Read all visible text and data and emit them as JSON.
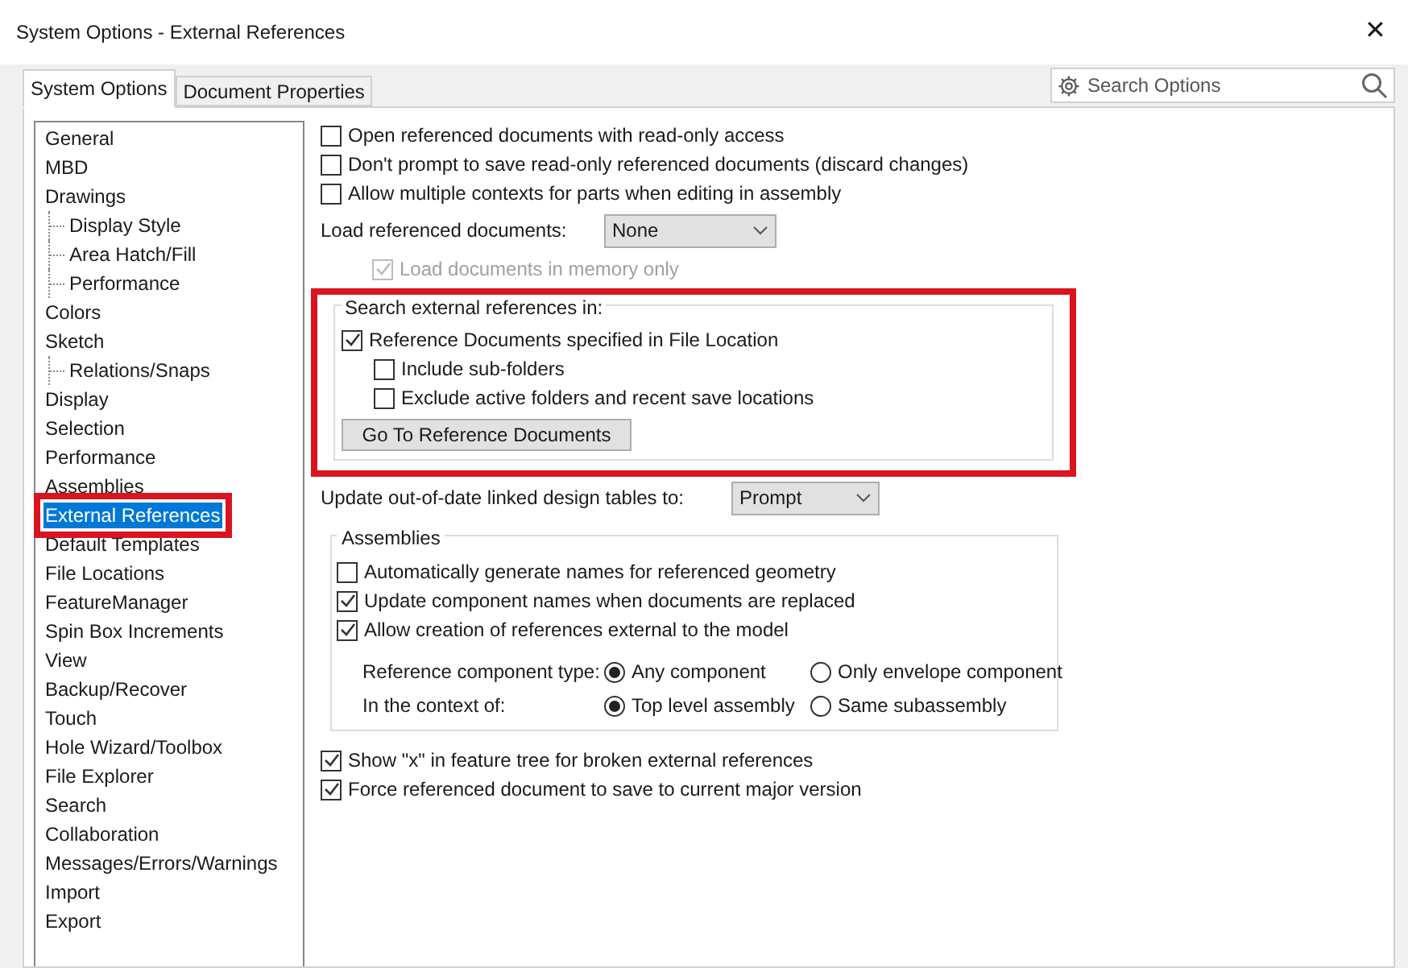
{
  "window": {
    "title": "System Options - External References",
    "close": "✕"
  },
  "tabs": [
    {
      "label": "System Options",
      "selected": true
    },
    {
      "label": "Document Properties",
      "selected": false
    }
  ],
  "search": {
    "placeholder": "Search Options"
  },
  "sidebar": {
    "items": [
      {
        "label": "General",
        "selected": false,
        "highlighted": false
      },
      {
        "label": "MBD",
        "selected": false,
        "highlighted": false
      },
      {
        "label": "Drawings",
        "selected": false,
        "highlighted": false,
        "children": [
          {
            "label": "Display Style",
            "selected": false,
            "highlighted": false
          },
          {
            "label": "Area Hatch/Fill",
            "selected": false,
            "highlighted": false
          },
          {
            "label": "Performance",
            "selected": false,
            "highlighted": false
          }
        ]
      },
      {
        "label": "Colors",
        "selected": false,
        "highlighted": false
      },
      {
        "label": "Sketch",
        "selected": false,
        "highlighted": false,
        "children": [
          {
            "label": "Relations/Snaps",
            "selected": false,
            "highlighted": false
          }
        ]
      },
      {
        "label": "Display",
        "selected": false,
        "highlighted": false
      },
      {
        "label": "Selection",
        "selected": false,
        "highlighted": false
      },
      {
        "label": "Performance",
        "selected": false,
        "highlighted": false
      },
      {
        "label": "Assemblies",
        "selected": false,
        "highlighted": false
      },
      {
        "label": "External References",
        "selected": true,
        "highlighted": true
      },
      {
        "label": "Default Templates",
        "selected": false,
        "highlighted": false
      },
      {
        "label": "File Locations",
        "selected": false,
        "highlighted": false
      },
      {
        "label": "FeatureManager",
        "selected": false,
        "highlighted": false
      },
      {
        "label": "Spin Box Increments",
        "selected": false,
        "highlighted": false
      },
      {
        "label": "View",
        "selected": false,
        "highlighted": false
      },
      {
        "label": "Backup/Recover",
        "selected": false,
        "highlighted": false
      },
      {
        "label": "Touch",
        "selected": false,
        "highlighted": false
      },
      {
        "label": "Hole Wizard/Toolbox",
        "selected": false,
        "highlighted": false
      },
      {
        "label": "File Explorer",
        "selected": false,
        "highlighted": false
      },
      {
        "label": "Search",
        "selected": false,
        "highlighted": false
      },
      {
        "label": "Collaboration",
        "selected": false,
        "highlighted": false
      },
      {
        "label": "Messages/Errors/Warnings",
        "selected": false,
        "highlighted": false
      },
      {
        "label": "Import",
        "selected": false,
        "highlighted": false
      },
      {
        "label": "Export",
        "selected": false,
        "highlighted": false
      }
    ]
  },
  "top_options": [
    {
      "label": "Open referenced documents with read-only access",
      "checked": false
    },
    {
      "label": "Don't prompt to save read-only referenced documents (discard changes)",
      "checked": false
    },
    {
      "label": "Allow multiple contexts for parts when editing in assembly",
      "checked": false
    }
  ],
  "load_referenced": {
    "label": "Load referenced documents:",
    "value": "None"
  },
  "memory_only": {
    "label": "Load documents in memory only",
    "checked": true,
    "disabled": true
  },
  "search_group": {
    "title": "Search external references in:",
    "highlighted": true,
    "options": [
      {
        "label": "Reference Documents specified in File Location",
        "checked": true,
        "children": [
          {
            "label": "Include sub-folders",
            "checked": false
          },
          {
            "label": "Exclude active folders and recent save locations",
            "checked": false
          }
        ]
      }
    ],
    "button": "Go To Reference Documents"
  },
  "design_tables": {
    "label": "Update out-of-date linked design tables to:",
    "value": "Prompt"
  },
  "assemblies": {
    "title": "Assemblies",
    "options": [
      {
        "label": "Automatically generate names for referenced geometry",
        "checked": false
      },
      {
        "label": "Update component names when documents are replaced",
        "checked": true
      },
      {
        "label": "Allow creation of references external to the model",
        "checked": true
      }
    ],
    "radio_rows": [
      {
        "label": "Reference component type:",
        "options": [
          {
            "label": "Any component",
            "selected": true
          },
          {
            "label": "Only envelope component",
            "selected": false
          }
        ]
      },
      {
        "label": "In the context of:",
        "options": [
          {
            "label": "Top level assembly",
            "selected": true
          },
          {
            "label": "Same subassembly",
            "selected": false
          }
        ]
      }
    ]
  },
  "bottom_options": [
    {
      "label": "Show \"x\" in feature tree for broken external references",
      "checked": true
    },
    {
      "label": "Force referenced document to save to current major version",
      "checked": true
    }
  ]
}
